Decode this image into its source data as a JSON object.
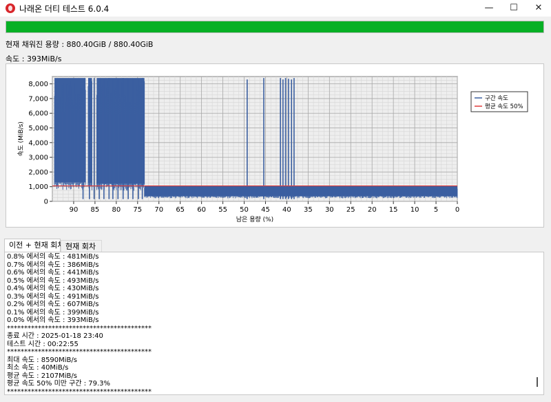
{
  "window": {
    "title": "나래온 더티 테스트 6.0.4"
  },
  "status": {
    "progress": 1.0,
    "capacity_text": "현재 채워진 용량 : 880.40GiB / 880.40GiB",
    "speed_text": "속도 : 393MiB/s"
  },
  "chart_data": {
    "type": "line",
    "xlabel": "남은 용량 (%)",
    "ylabel": "속도 (MiB/s)",
    "x_reversed": true,
    "xlim": [
      95,
      0
    ],
    "ylim": [
      0,
      8500
    ],
    "x_ticks": [
      90,
      85,
      80,
      75,
      70,
      65,
      60,
      55,
      50,
      45,
      40,
      35,
      30,
      25,
      20,
      15,
      10,
      5,
      0
    ],
    "y_ticks": [
      0,
      1000,
      2000,
      3000,
      4000,
      5000,
      6000,
      7000,
      8000
    ],
    "y_tick_labels": [
      "0",
      "1,000",
      "2,000",
      "3,000",
      "4,000",
      "5,000",
      "6,000",
      "7,000",
      "8,000"
    ],
    "grid": true,
    "legend_position": "right",
    "series": [
      {
        "name": "구간 속도",
        "color": "#3b5fa0",
        "segments": [
          {
            "x_start": 94.5,
            "x_end": 87.2,
            "low": 1300,
            "high": 8400
          },
          {
            "x_start": 86.6,
            "x_end": 85.7,
            "low": 1250,
            "high": 8400
          },
          {
            "x_start": 84.6,
            "x_end": 73.4,
            "low": 1200,
            "high": 8400
          },
          {
            "x_start": 73.4,
            "x_end": 0,
            "low": 350,
            "high": 1050
          }
        ],
        "spikes": [
          {
            "x": 87.8,
            "value": 8300
          },
          {
            "x": 86.3,
            "value": 8350
          },
          {
            "x": 85.2,
            "value": 8400
          },
          {
            "x": 84.0,
            "value": 8350
          },
          {
            "x": 82.9,
            "value": 8300
          },
          {
            "x": 81.7,
            "value": 8400
          },
          {
            "x": 80.8,
            "value": 8350
          },
          {
            "x": 79.6,
            "value": 8300
          },
          {
            "x": 78.4,
            "value": 8400
          },
          {
            "x": 77.2,
            "value": 8350
          },
          {
            "x": 76.1,
            "value": 8300
          },
          {
            "x": 74.8,
            "value": 8350
          },
          {
            "x": 73.9,
            "value": 8400
          },
          {
            "x": 49.3,
            "value": 8300
          },
          {
            "x": 45.4,
            "value": 8400
          },
          {
            "x": 41.5,
            "value": 8400
          },
          {
            "x": 40.9,
            "value": 8300
          },
          {
            "x": 40.3,
            "value": 8400
          },
          {
            "x": 39.6,
            "value": 8350
          },
          {
            "x": 38.9,
            "value": 8300
          },
          {
            "x": 38.3,
            "value": 8400
          }
        ]
      },
      {
        "name": "평균 속도 50%",
        "color": "#e03c3c",
        "x": [
          95,
          0
        ],
        "y": [
          1053,
          1053
        ]
      }
    ]
  },
  "tabs": [
    {
      "label": "이전 + 현재 회차"
    },
    {
      "label": "현재 회차"
    }
  ],
  "log": {
    "lines": [
      "0.8% 에서의 속도 : 481MiB/s",
      "0.7% 에서의 속도 : 386MiB/s",
      "0.6% 에서의 속도 : 441MiB/s",
      "0.5% 에서의 속도 : 493MiB/s",
      "0.4% 에서의 속도 : 430MiB/s",
      "0.3% 에서의 속도 : 491MiB/s",
      "0.2% 에서의 속도 : 607MiB/s",
      "0.1% 에서의 속도 : 399MiB/s",
      "0.0% 에서의 속도 : 393MiB/s",
      "******************************************",
      "종료 시간 : 2025-01-18 23:40",
      "테스트 시간 : 00:22:55",
      "******************************************",
      "최대 속도 : 8590MiB/s",
      "최소 속도 : 40MiB/s",
      "평균 속도 : 2107MiB/s",
      "평균 속도 50% 미만 구간 : 79.3%",
      "******************************************"
    ]
  }
}
